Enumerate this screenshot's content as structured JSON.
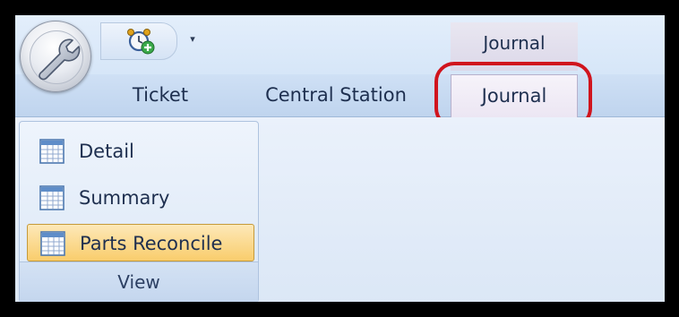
{
  "context_tab_header": "Journal",
  "qat": {
    "icon": "alarm-clock-add-icon",
    "dropdown_glyph": "▾"
  },
  "app_button": {
    "icon": "wrench-icon"
  },
  "tabs": [
    {
      "label": "Ticket"
    },
    {
      "label": "Central Station"
    },
    {
      "label": "Journal",
      "selected": true
    }
  ],
  "highlight_color": "#d0141d",
  "ribbon": {
    "group": {
      "label": "View",
      "items": [
        {
          "label": "Detail",
          "icon": "table-icon"
        },
        {
          "label": "Summary",
          "icon": "table-icon"
        },
        {
          "label": "Parts Reconcile",
          "icon": "table-icon",
          "active": true
        }
      ]
    }
  }
}
